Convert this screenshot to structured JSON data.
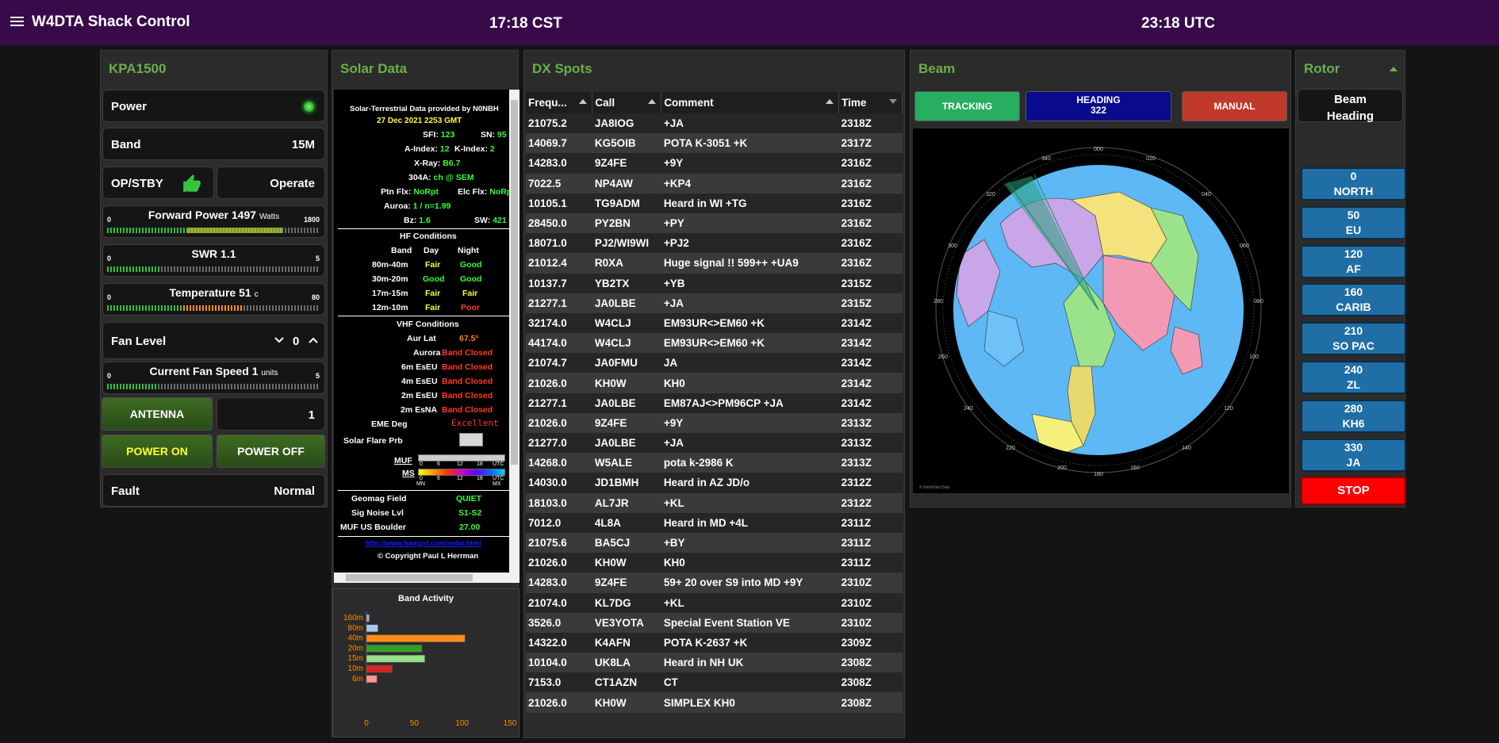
{
  "app": {
    "title": "W4DTA Shack Control",
    "local_time": "17:18 CST",
    "utc_time": "23:18 UTC"
  },
  "kpa": {
    "title": "KPA1500",
    "power_label": "Power",
    "band_label": "Band",
    "band_value": "15M",
    "opstby_label": "OP/STBY",
    "operate_label": "Operate",
    "forward": {
      "title": "Forward Power 1497",
      "unit": "Watts",
      "min": "0",
      "max": "1800",
      "level": 0.83,
      "warn": 0.45
    },
    "swr": {
      "title": "SWR 1.1",
      "min": "0",
      "max": "5",
      "level": 0.25,
      "warn": 0
    },
    "temp": {
      "title": "Temperature 51",
      "unit": "c",
      "min": "0",
      "max": "80",
      "level": 0.64,
      "warn": 0.28
    },
    "fan_label": "Fan Level",
    "fan_value": "0",
    "fanspeed": {
      "title": "Current Fan Speed 1",
      "unit": "units",
      "min": "0",
      "max": "5",
      "level": 0.23,
      "warn": 0
    },
    "antenna_label": "ANTENNA",
    "antenna_value": "1",
    "power_on": "POWER ON",
    "power_off": "POWER OFF",
    "fault_label": "Fault",
    "fault_value": "Normal"
  },
  "solar": {
    "title": "Solar Data",
    "provided_by": "Solar-Terrestrial Data provided by N0NBH",
    "date": "27 Dec 2021 2253 GMT",
    "sfi_label": "SFI:",
    "sfi": "123",
    "sn_label": "SN:",
    "sn": "95",
    "aindex_label": "A-Index:",
    "aindex": "12",
    "kindex_label": "K-Index:",
    "kindex": "2",
    "xray_label": "X-Ray:",
    "xray": "B6.7",
    "a304_label": "304A:",
    "a304": "ch @ SEM",
    "ptn_label": "Ptn Flx:",
    "ptn": "NoRpt",
    "elc_label": "Elc Flx:",
    "elc": "NoRpt",
    "aurora_label": "Auroa:",
    "aurora": "1 / n=1.99",
    "bz_label": "Bz:",
    "bz": "1.6",
    "sw_label": "SW:",
    "sw": "421",
    "hf_title": "HF Conditions",
    "hf_headers": [
      "Band",
      "Day",
      "Night"
    ],
    "hf_rows": [
      {
        "band": "80m-40m",
        "day": "Fair",
        "night": "Good"
      },
      {
        "band": "30m-20m",
        "day": "Good",
        "night": "Good"
      },
      {
        "band": "17m-15m",
        "day": "Fair",
        "night": "Fair"
      },
      {
        "band": "12m-10m",
        "day": "Fair",
        "night": "Poor"
      }
    ],
    "vhf_title": "VHF Conditions",
    "aurlat_label": "Aur Lat",
    "aurlat": "67.5°",
    "vhf_rows": [
      {
        "label": "Aurora",
        "value": "Band Closed"
      },
      {
        "label": "6m EsEU",
        "value": "Band Closed"
      },
      {
        "label": "4m EsEU",
        "value": "Band Closed"
      },
      {
        "label": "2m EsEU",
        "value": "Band Closed"
      },
      {
        "label": "2m EsNA",
        "value": "Band Closed"
      }
    ],
    "eme_label": "EME Deg",
    "eme": "Excellent",
    "flare_label": "Solar Flare Prb",
    "muf_label": "MUF",
    "ms_label": "MS",
    "muf_ticks": [
      "0",
      "6",
      "12",
      "18",
      "UTC"
    ],
    "mn_label": "MN",
    "mx_label": "MX",
    "geomag_label": "Geomag Field",
    "geomag": "QUIET",
    "signoise_label": "Sig Noise Lvl",
    "signoise": "S1-S2",
    "mufus_label": "MUF US Boulder",
    "mufus": "27.00",
    "link": "http://www.hamqsl.com/solar.html",
    "copyright": "© Copyright Paul L Herrman"
  },
  "band_activity": {
    "title": "Band Activity"
  },
  "chart_data": {
    "type": "bar",
    "title": "Band Activity",
    "categories": [
      "160m",
      "80m",
      "40m",
      "20m",
      "15m",
      "10m",
      "6m"
    ],
    "values": [
      3,
      12,
      103,
      58,
      61,
      27,
      11
    ],
    "xlim": [
      0,
      150
    ],
    "xticks": [
      "0",
      "50",
      "100",
      "150"
    ],
    "colors": [
      "#8fb6e4",
      "#a9c8ef",
      "#ff8c1a",
      "#33a02c",
      "#98df8a",
      "#d62728",
      "#ff9896"
    ]
  },
  "dx": {
    "title": "DX Spots",
    "headers": [
      "Frequ...",
      "Call",
      "Comment",
      "Time"
    ],
    "rows": [
      [
        "21075.2",
        "JA8IOG",
        "+JA",
        "2318Z"
      ],
      [
        "14069.7",
        "KG5OIB",
        "POTA K-3051 +K",
        "2317Z"
      ],
      [
        "14283.0",
        "9Z4FE",
        "+9Y",
        "2316Z"
      ],
      [
        "7022.5",
        "NP4AW",
        "+KP4",
        "2316Z"
      ],
      [
        "10105.1",
        "TG9ADM",
        "Heard in WI +TG",
        "2316Z"
      ],
      [
        "28450.0",
        "PY2BN",
        "+PY",
        "2316Z"
      ],
      [
        "18071.0",
        "PJ2/WI9WI",
        "+PJ2",
        "2316Z"
      ],
      [
        "21012.4",
        "R0XA",
        "Huge signal !! 599++ +UA9",
        "2316Z"
      ],
      [
        "10137.7",
        "YB2TX",
        "+YB",
        "2315Z"
      ],
      [
        "21277.1",
        "JA0LBE",
        "+JA",
        "2315Z"
      ],
      [
        "32174.0",
        "W4CLJ",
        "EM93UR<>EM60 +K",
        "2314Z"
      ],
      [
        "44174.0",
        "W4CLJ",
        "EM93UR<>EM60 +K",
        "2314Z"
      ],
      [
        "21074.7",
        "JA0FMU",
        "JA",
        "2314Z"
      ],
      [
        "21026.0",
        "KH0W",
        "KH0",
        "2314Z"
      ],
      [
        "21277.1",
        "JA0LBE",
        "EM87AJ<>PM96CP +JA",
        "2314Z"
      ],
      [
        "21026.0",
        "9Z4FE",
        "+9Y",
        "2313Z"
      ],
      [
        "21277.0",
        "JA0LBE",
        "+JA",
        "2313Z"
      ],
      [
        "14268.0",
        "W5ALE",
        "pota k-2986 K",
        "2313Z"
      ],
      [
        "14030.0",
        "JD1BMH",
        "Heard in AZ JD/o",
        "2312Z"
      ],
      [
        "18103.0",
        "AL7JR",
        "+KL",
        "2312Z"
      ],
      [
        "7012.0",
        "4L8A",
        "Heard in MD +4L",
        "2311Z"
      ],
      [
        "21075.6",
        "BA5CJ",
        "+BY",
        "2311Z"
      ],
      [
        "21026.0",
        "KH0W",
        "KH0",
        "2311Z"
      ],
      [
        "14283.0",
        "9Z4FE",
        "59+ 20 over S9 into MD +9Y",
        "2310Z"
      ],
      [
        "21074.0",
        "KL7DG",
        "+KL",
        "2310Z"
      ],
      [
        "3526.0",
        "VE3YOTA",
        "Special Event Station VE",
        "2310Z"
      ],
      [
        "14322.0",
        "K4AFN",
        "POTA K-2637 +K",
        "2309Z"
      ],
      [
        "10104.0",
        "UK8LA",
        "Heard in NH UK",
        "2308Z"
      ],
      [
        "7153.0",
        "CT1AZN",
        "CT",
        "2308Z"
      ],
      [
        "21026.0",
        "KH0W",
        "SIMPLEX KH0",
        "2308Z"
      ]
    ]
  },
  "beam": {
    "title": "Beam",
    "tracking": "TRACKING",
    "heading_label": "HEADING",
    "heading_value": "322",
    "manual": "MANUAL",
    "azimuth_ticks": [
      "000",
      "020",
      "340",
      "040",
      "320",
      "060",
      "300",
      "080",
      "280",
      "100",
      "260",
      "120",
      "240",
      "140",
      "220",
      "160",
      "200",
      "180"
    ],
    "credit": "© NorthStar Data"
  },
  "rotor": {
    "title": "Rotor",
    "beam_heading_label": "Beam Heading",
    "buttons": [
      {
        "deg": "0",
        "name": "NORTH"
      },
      {
        "deg": "50",
        "name": "EU"
      },
      {
        "deg": "120",
        "name": "AF"
      },
      {
        "deg": "160",
        "name": "CARIB"
      },
      {
        "deg": "210",
        "name": "SO PAC"
      },
      {
        "deg": "240",
        "name": "ZL"
      },
      {
        "deg": "280",
        "name": "KH6"
      },
      {
        "deg": "330",
        "name": "JA"
      }
    ],
    "stop": "STOP"
  },
  "colors": {
    "header": "#380a4a",
    "accent": "#6ab04c",
    "tracking": "#27ae60",
    "heading": "#0a0a8c",
    "manual": "#c0392b",
    "stop": "#ff0000",
    "rotor_btn": "#1f6ea6"
  }
}
